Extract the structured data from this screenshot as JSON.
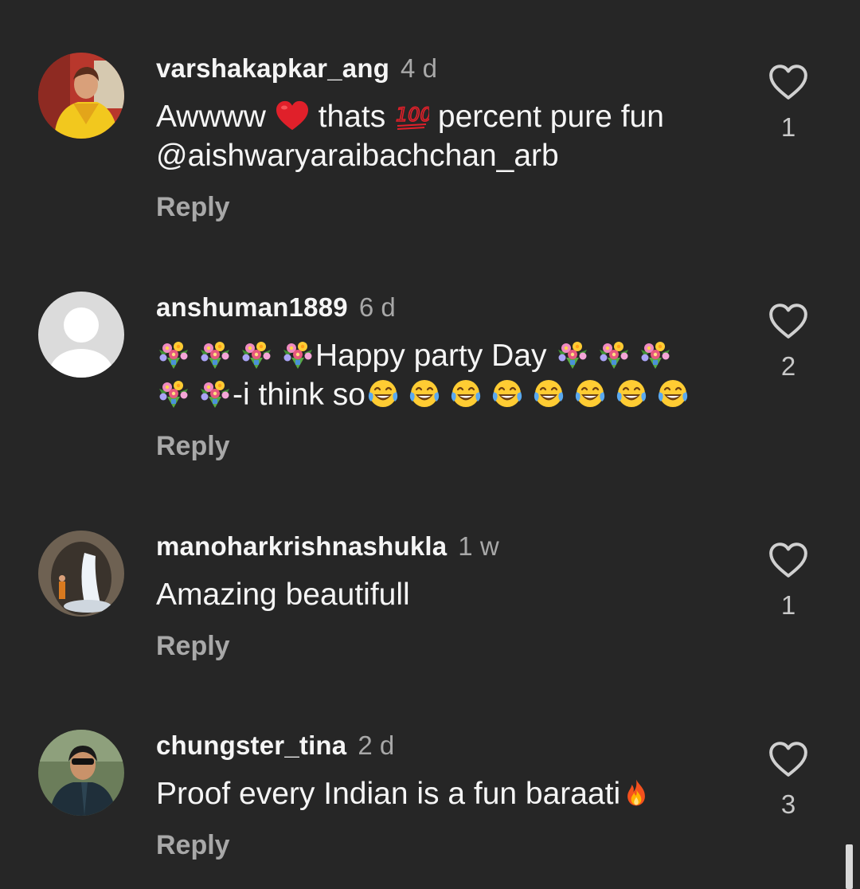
{
  "comments": [
    {
      "username": "varshakapkar_ang",
      "time": "4 d",
      "text_parts": [
        "Awwww ",
        " thats ",
        " percent pure fun",
        "@aishwaryaraibachchan_arb"
      ],
      "reply_label": "Reply",
      "likes": "1"
    },
    {
      "username": "anshuman1889",
      "time": "6 d",
      "text_parts": [
        "Happy party Day ",
        "-i think so"
      ],
      "reply_label": "Reply",
      "likes": "2"
    },
    {
      "username": "manoharkrishnashukla",
      "time": "1 w",
      "text": "Amazing beautifull",
      "reply_label": "Reply",
      "likes": "1"
    },
    {
      "username": "chungster_tina",
      "time": "2 d",
      "text": "Proof every Indian is a fun baraati",
      "reply_label": "Reply",
      "likes": "3"
    }
  ],
  "icons": {
    "like": "heart-outline-icon",
    "emoji_heart": "red-heart-emoji",
    "emoji_hundred": "hundred-points-emoji",
    "emoji_bouquet": "bouquet-emoji",
    "emoji_laugh": "tears-of-joy-emoji",
    "emoji_fire": "fire-emoji"
  },
  "colors": {
    "background": "#262626",
    "username": "#f5f5f5",
    "secondary": "#a8a8a8"
  }
}
